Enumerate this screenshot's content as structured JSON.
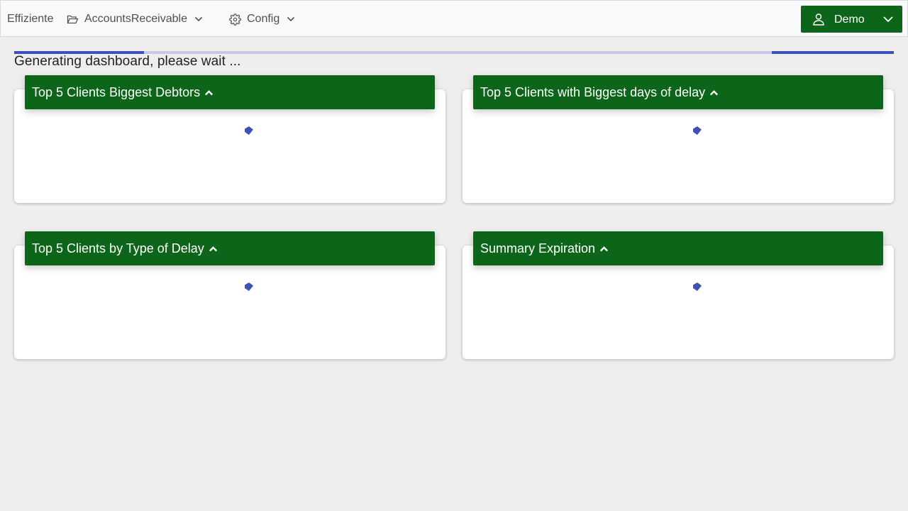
{
  "navbar": {
    "brand": "Effiziente",
    "accounts_menu": {
      "label": "AccountsReceivable",
      "icon": "folder-open-icon"
    },
    "config_menu": {
      "label": "Config",
      "icon": "gear-icon"
    },
    "user_menu": {
      "label": "Demo",
      "icon": "user-icon"
    }
  },
  "status": {
    "message": "Generating dashboard, please wait ..."
  },
  "widgets": [
    {
      "title": "Top 5 Clients Biggest Debtors"
    },
    {
      "title": "Top 5 Clients with Biggest days of delay"
    },
    {
      "title": "Top 5 Clients by Type of Delay"
    },
    {
      "title": "Summary Expiration"
    }
  ],
  "colors": {
    "header_green": "#0c6519",
    "progress_blue": "#3f51b5",
    "progress_track": "#c5c9e3",
    "background": "#eeeeee"
  }
}
